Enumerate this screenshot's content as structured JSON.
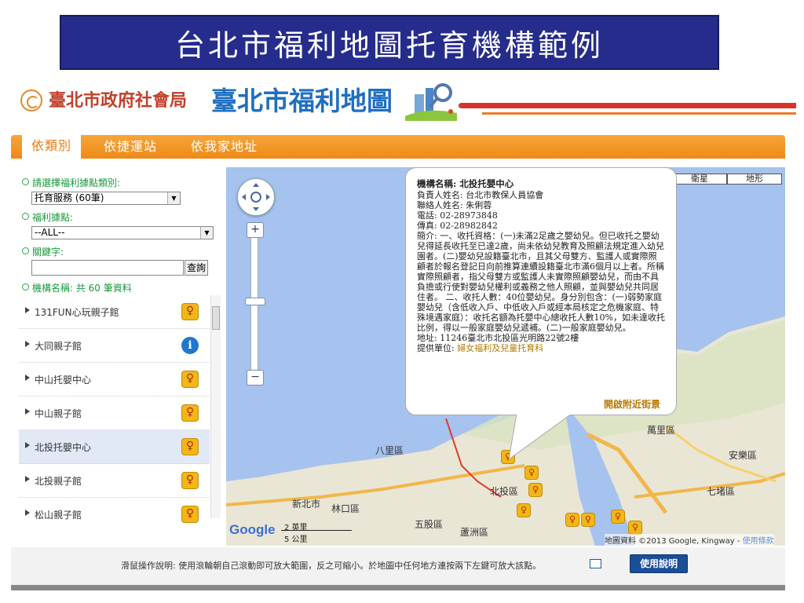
{
  "slide_title": "台北市福利地圖托育機構範例",
  "brand": {
    "department": "臺北市政府社會局",
    "map_name": "臺北市福利地圖"
  },
  "tabs": [
    "依類別",
    "依捷運站",
    "依我家地址"
  ],
  "sidebar": {
    "category_label": "請選擇福利據點類別:",
    "category_value": "托育服務 (60筆)",
    "point_label": "福利據點:",
    "point_value": "--ALL--",
    "keyword_label": "關鍵字:",
    "keyword_value": "",
    "query_button": "查詢",
    "count_text": "機構名稱: 共 60 筆資料",
    "items": [
      {
        "name": "131FUN心玩親子館",
        "icon": "badge"
      },
      {
        "name": "大同親子館",
        "icon": "info"
      },
      {
        "name": "中山托嬰中心",
        "icon": "badge"
      },
      {
        "name": "中山親子館",
        "icon": "badge"
      },
      {
        "name": "北投托嬰中心",
        "icon": "badge"
      },
      {
        "name": "北投親子館",
        "icon": "badge"
      },
      {
        "name": "松山親子館",
        "icon": "badge"
      }
    ]
  },
  "map": {
    "types": [
      "地圖",
      "衛星",
      "地形"
    ],
    "place_labels": {
      "bali": "八里區",
      "beitou": "北投區",
      "linkou": "林口區",
      "wugu": "五股區",
      "luzhou": "蘆洲區",
      "wanli": "萬里區",
      "anle": "安樂區",
      "qidu": "七堵區",
      "xinbei": "新北市"
    },
    "scale_label_1": "2 英里",
    "scale_label_2": "5 公里",
    "google_logo": "Google",
    "attribution": "地圖資料 ©2013 Google, Kingway",
    "terms": "使用條款",
    "popup": {
      "title": "機構名稱: 北投托嬰中心",
      "lines": [
        "負責人姓名: 台北市教保人員協會",
        "聯絡人姓名: 朱俐蓉",
        "電話: 02-28973848",
        "傳真: 02-28982842",
        "簡介: 一、收托資格：(一)未滿2足歲之嬰幼兒。但已收托之嬰幼兒得延長收托至已達2歲，尚未依幼兒教育及照顧法規定進入幼兒園者。(二)嬰幼兒設籍臺北市，且其父母雙方、監護人或實際照顧者於報名登記日向前推算連續設籍臺北市滿6個月以上者。所稱實際照顧者，指父母雙方或監護人未實際照顧嬰幼兒，而由不具負擔或行使對嬰幼兒權利或義務之他人照顧，並與嬰幼兒共同居住者。 二、收托人數：40位嬰幼兒。身分別包含：(一)弱勢家庭嬰幼兒（含低收入戶、中低收入戶或經本局核定之危機家庭、特殊境遇家庭）：收托名額為托嬰中心總收托人數10%，如未達收托比例，得以一般家庭嬰幼兒遞補。(二)一般家庭嬰幼兒。",
        "地址: 11246臺北市北投區光明路22號2樓"
      ],
      "provider_label": "提供單位: ",
      "provider": "婦女福利及兒童托育科",
      "nearby_link": "開啟附近街景"
    }
  },
  "footer": {
    "instructions": "滑鼠操作說明: 使用滾輪朝自己滾動即可放大範圍，反之可縮小。於地圖中任何地方連按兩下左鍵可放大該點。",
    "help_button": "使用說明"
  },
  "colors": {
    "title_bg": "#252c8c",
    "tab_orange": "#f39a27",
    "map_water": "#a6c2ee",
    "label_green": "#1a9a3a",
    "help_blue": "#1b4e97"
  }
}
